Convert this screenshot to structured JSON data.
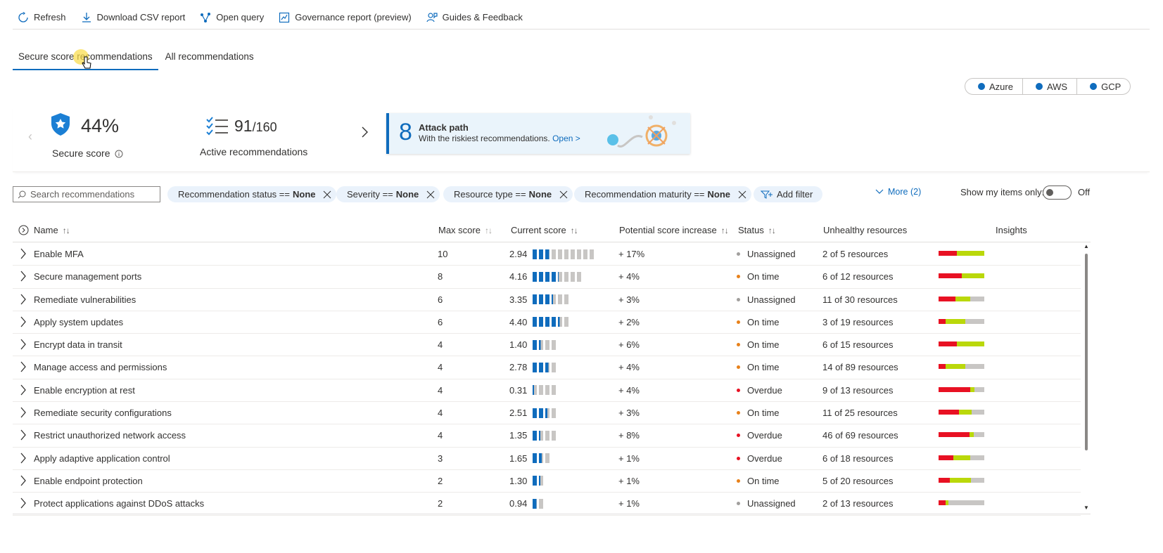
{
  "toolbar": {
    "refresh": "Refresh",
    "download": "Download CSV report",
    "open_query": "Open query",
    "governance": "Governance report (preview)",
    "guides": "Guides & Feedback"
  },
  "tabs": [
    "Secure score recommendations",
    "All recommendations"
  ],
  "clouds": [
    "Azure",
    "AWS",
    "GCP"
  ],
  "summary": {
    "secure_score": "44%",
    "secure_score_label": "Secure score",
    "active_count": "91",
    "active_total": "/160",
    "active_label": "Active recommendations",
    "attack_count": "8",
    "attack_title": "Attack path",
    "attack_desc": "With the riskiest recommendations.",
    "attack_link": "Open >"
  },
  "filters": {
    "search_placeholder": "Search recommendations",
    "pills": [
      {
        "label": "Recommendation status ==",
        "value": "None"
      },
      {
        "label": "Severity ==",
        "value": "None"
      },
      {
        "label": "Resource type ==",
        "value": "None"
      },
      {
        "label": "Recommendation maturity ==",
        "value": "None"
      }
    ],
    "add_filter": "Add filter",
    "more": "More (2)",
    "my_items": "Show my items only:",
    "toggle_state": "Off"
  },
  "table": {
    "headers": {
      "name": "Name",
      "max": "Max score",
      "current": "Current score",
      "potential": "Potential score increase",
      "status": "Status",
      "unhealthy": "Unhealthy resources",
      "insights": "Insights"
    },
    "status_colors": {
      "Unassigned": "#a19f9d",
      "On time": "#e8811a",
      "Overdue": "#e81123"
    },
    "rows": [
      {
        "name": "Enable MFA",
        "max": "10",
        "current": "2.94",
        "filled": 3,
        "total": 10,
        "potential": "+ 17%",
        "status": "Unassigned",
        "unhealthy": "2 of 5 resources",
        "health": [
          0.4,
          0.6,
          0
        ]
      },
      {
        "name": "Secure management ports",
        "max": "8",
        "current": "4.16",
        "filled": 4,
        "total": 8,
        "potential": "+ 4%",
        "status": "On time",
        "unhealthy": "6 of 12 resources",
        "health": [
          0.5,
          0.5,
          0
        ]
      },
      {
        "name": "Remediate vulnerabilities",
        "max": "6",
        "current": "3.35",
        "filled": 3,
        "total": 6,
        "potential": "+ 3%",
        "status": "Unassigned",
        "unhealthy": "11 of 30 resources",
        "health": [
          0.37,
          0.33,
          0.3
        ]
      },
      {
        "name": "Apply system updates",
        "max": "6",
        "current": "4.40",
        "filled": 4,
        "total": 6,
        "potential": "+ 2%",
        "status": "On time",
        "unhealthy": "3 of 19 resources",
        "health": [
          0.16,
          0.42,
          0.42
        ]
      },
      {
        "name": "Encrypt data in transit",
        "max": "4",
        "current": "1.40",
        "filled": 1,
        "total": 4,
        "potential": "+ 6%",
        "status": "On time",
        "unhealthy": "6 of 15 resources",
        "health": [
          0.4,
          0.6,
          0
        ]
      },
      {
        "name": "Manage access and permissions",
        "max": "4",
        "current": "2.78",
        "filled": 3,
        "total": 4,
        "potential": "+ 4%",
        "status": "On time",
        "unhealthy": "14 of 89 resources",
        "health": [
          0.16,
          0.42,
          0.42
        ]
      },
      {
        "name": "Enable encryption at rest",
        "max": "4",
        "current": "0.31",
        "filled": 0,
        "total": 4,
        "potential": "+ 4%",
        "status": "Overdue",
        "unhealthy": "9 of 13 resources",
        "health": [
          0.69,
          0.09,
          0.22
        ]
      },
      {
        "name": "Remediate security configurations",
        "max": "4",
        "current": "2.51",
        "filled": 2,
        "total": 4,
        "potential": "+ 3%",
        "status": "On time",
        "unhealthy": "11 of 25 resources",
        "health": [
          0.44,
          0.28,
          0.28
        ]
      },
      {
        "name": "Restrict unauthorized network access",
        "max": "4",
        "current": "1.35",
        "filled": 1,
        "total": 4,
        "potential": "+ 8%",
        "status": "Overdue",
        "unhealthy": "46 of 69 resources",
        "health": [
          0.67,
          0.1,
          0.23
        ]
      },
      {
        "name": "Apply adaptive application control",
        "max": "3",
        "current": "1.65",
        "filled": 2,
        "total": 3,
        "potential": "+ 1%",
        "status": "Overdue",
        "unhealthy": "6 of 18 resources",
        "health": [
          0.33,
          0.37,
          0.3
        ]
      },
      {
        "name": "Enable endpoint protection",
        "max": "2",
        "current": "1.30",
        "filled": 1,
        "total": 2,
        "potential": "+ 1%",
        "status": "On time",
        "unhealthy": "5 of 20 resources",
        "health": [
          0.25,
          0.45,
          0.3
        ]
      },
      {
        "name": "Protect applications against DDoS attacks",
        "max": "2",
        "current": "0.94",
        "filled": 1,
        "total": 2,
        "potential": "+ 1%",
        "status": "Unassigned",
        "unhealthy": "2 of 13 resources",
        "health": [
          0.15,
          0.07,
          0.78
        ]
      }
    ]
  }
}
